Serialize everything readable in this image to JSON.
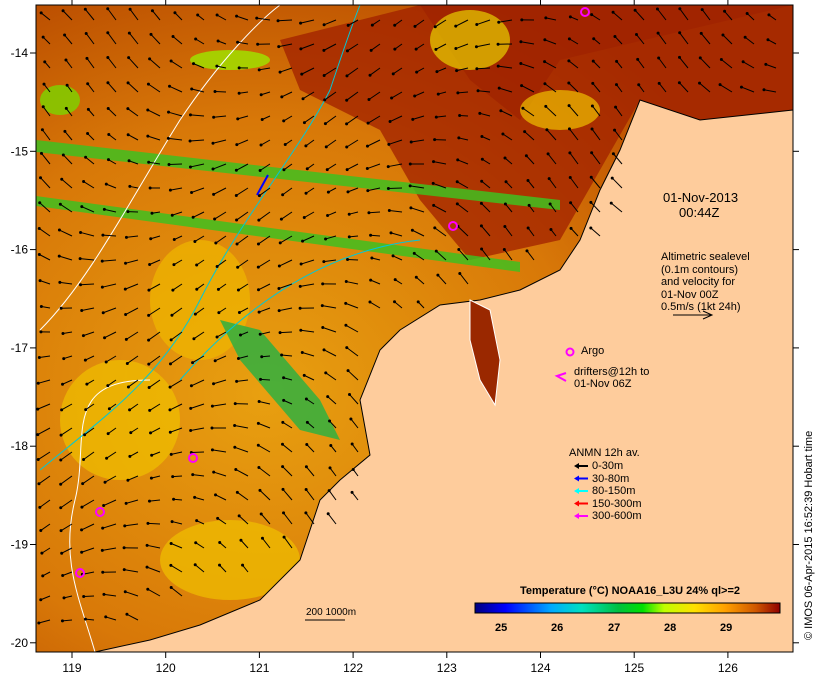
{
  "map": {
    "date": "01-Nov-2013",
    "time": "00:44Z",
    "altimetry": [
      "Altimetric sealevel",
      "(0.1m contours)",
      "and velocity for",
      "01-Nov 00Z",
      "0.5m/s (1kt 24h)"
    ],
    "argo_label": "Argo",
    "drifters": [
      "drifters@12h to",
      "01-Nov 06Z"
    ],
    "anmn": {
      "title": "ANMN 12h av.",
      "items": [
        {
          "label": "0-30m",
          "color": "#000000"
        },
        {
          "label": "30-80m",
          "color": "#0000ff"
        },
        {
          "label": "80-150m",
          "color": "#00ffff"
        },
        {
          "label": "150-300m",
          "color": "#ff0000"
        },
        {
          "label": "300-600m",
          "color": "#ff00ff"
        }
      ]
    },
    "isobath_label": "200  1000m",
    "colorbar": {
      "title": "Temperature (°C) NOAA16_L3U 24% ql>=2",
      "ticks": [
        "25",
        "26",
        "27",
        "28",
        "29"
      ],
      "colors": [
        "#00007f",
        "#0000ff",
        "#00aaff",
        "#00e0c0",
        "#00c040",
        "#00e000",
        "#c0ff00",
        "#ffe000",
        "#ffa000",
        "#e06000",
        "#900000"
      ]
    },
    "lon_ticks": [
      "119",
      "120",
      "121",
      "122",
      "123",
      "124",
      "125",
      "126"
    ],
    "lat_ticks": [
      "-14",
      "-15",
      "-16",
      "-17",
      "-18",
      "-19",
      "-20"
    ],
    "credit": "© IMOS 06-Apr-2015 16:52:39 Hobart time",
    "colors": {
      "land": "#fecc9c",
      "sea_warm": "#d46a00",
      "sea_hot": "#9a1a00"
    }
  }
}
